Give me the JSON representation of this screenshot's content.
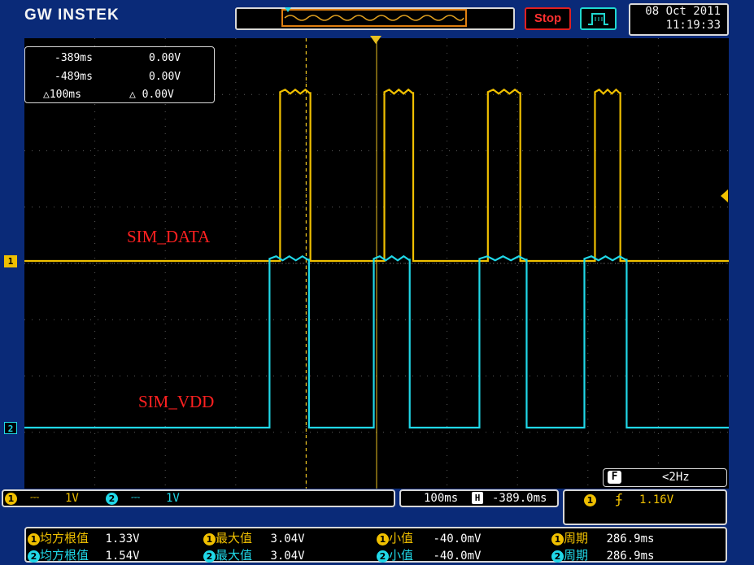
{
  "header": {
    "brand": "GW INSTEK",
    "run_state": "Stop",
    "date": "08 Oct 2011",
    "time": "11:19:33"
  },
  "cursor_readout": {
    "c1_time": "-389ms",
    "c1_value": "0.00V",
    "c2_time": "-489ms",
    "c2_value": "0.00V",
    "delta_time": "△100ms",
    "delta_value": "△ 0.00V"
  },
  "waveform_labels": {
    "ch1": "SIM_DATA",
    "ch2": "SIM_VDD"
  },
  "channel_markers": {
    "ch1": "1",
    "ch2": "2"
  },
  "freq_counter": {
    "icon_label": "F",
    "value": "<2Hz"
  },
  "channels": [
    {
      "num": "1",
      "coupling_icon": "dc-coupling-icon",
      "volts_div": "1V",
      "color": "#f0c000"
    },
    {
      "num": "2",
      "coupling_icon": "dc-coupling-icon",
      "volts_div": "1V",
      "color": "#20d8e8"
    }
  ],
  "timebase": {
    "time_div": "100ms",
    "position_icon": "H",
    "position": "-389.0ms"
  },
  "trigger": {
    "source": "1",
    "slope_icon": "rising-edge-icon",
    "level": "1.16V"
  },
  "measurements": [
    {
      "ch": "1",
      "rms_label": "均方根值",
      "rms": "1.33V",
      "max_label": "最大值",
      "max": "3.04V",
      "min_label": "小值",
      "min": "-40.0mV",
      "period_label": "周期",
      "period": "286.9ms"
    },
    {
      "ch": "2",
      "rms_label": "均方根值",
      "rms": "1.54V",
      "max_label": "最大值",
      "max": "3.04V",
      "min_label": "小值",
      "min": "-40.0mV",
      "period_label": "周期",
      "period": "286.9ms"
    }
  ],
  "colors": {
    "ch1": "#f0c000",
    "ch2": "#20d8e8",
    "frame": "#0a2a78",
    "stop": "#ff3030"
  },
  "waveforms": {
    "time_unit": "ms",
    "volts_unit": "V",
    "ch1_pulses_ms": [
      [
        -526,
        -483
      ],
      [
        -378,
        -337
      ],
      [
        -231,
        -185
      ],
      [
        -79,
        -43
      ]
    ],
    "ch1_high_V": 3.0,
    "ch1_low_V": 0.0,
    "ch2_pulses_ms": [
      [
        -541,
        -485
      ],
      [
        -393,
        -342
      ],
      [
        -243,
        -176
      ],
      [
        -94,
        -34
      ]
    ],
    "ch2_high_V": 3.0,
    "ch2_low_V": 0.0
  }
}
